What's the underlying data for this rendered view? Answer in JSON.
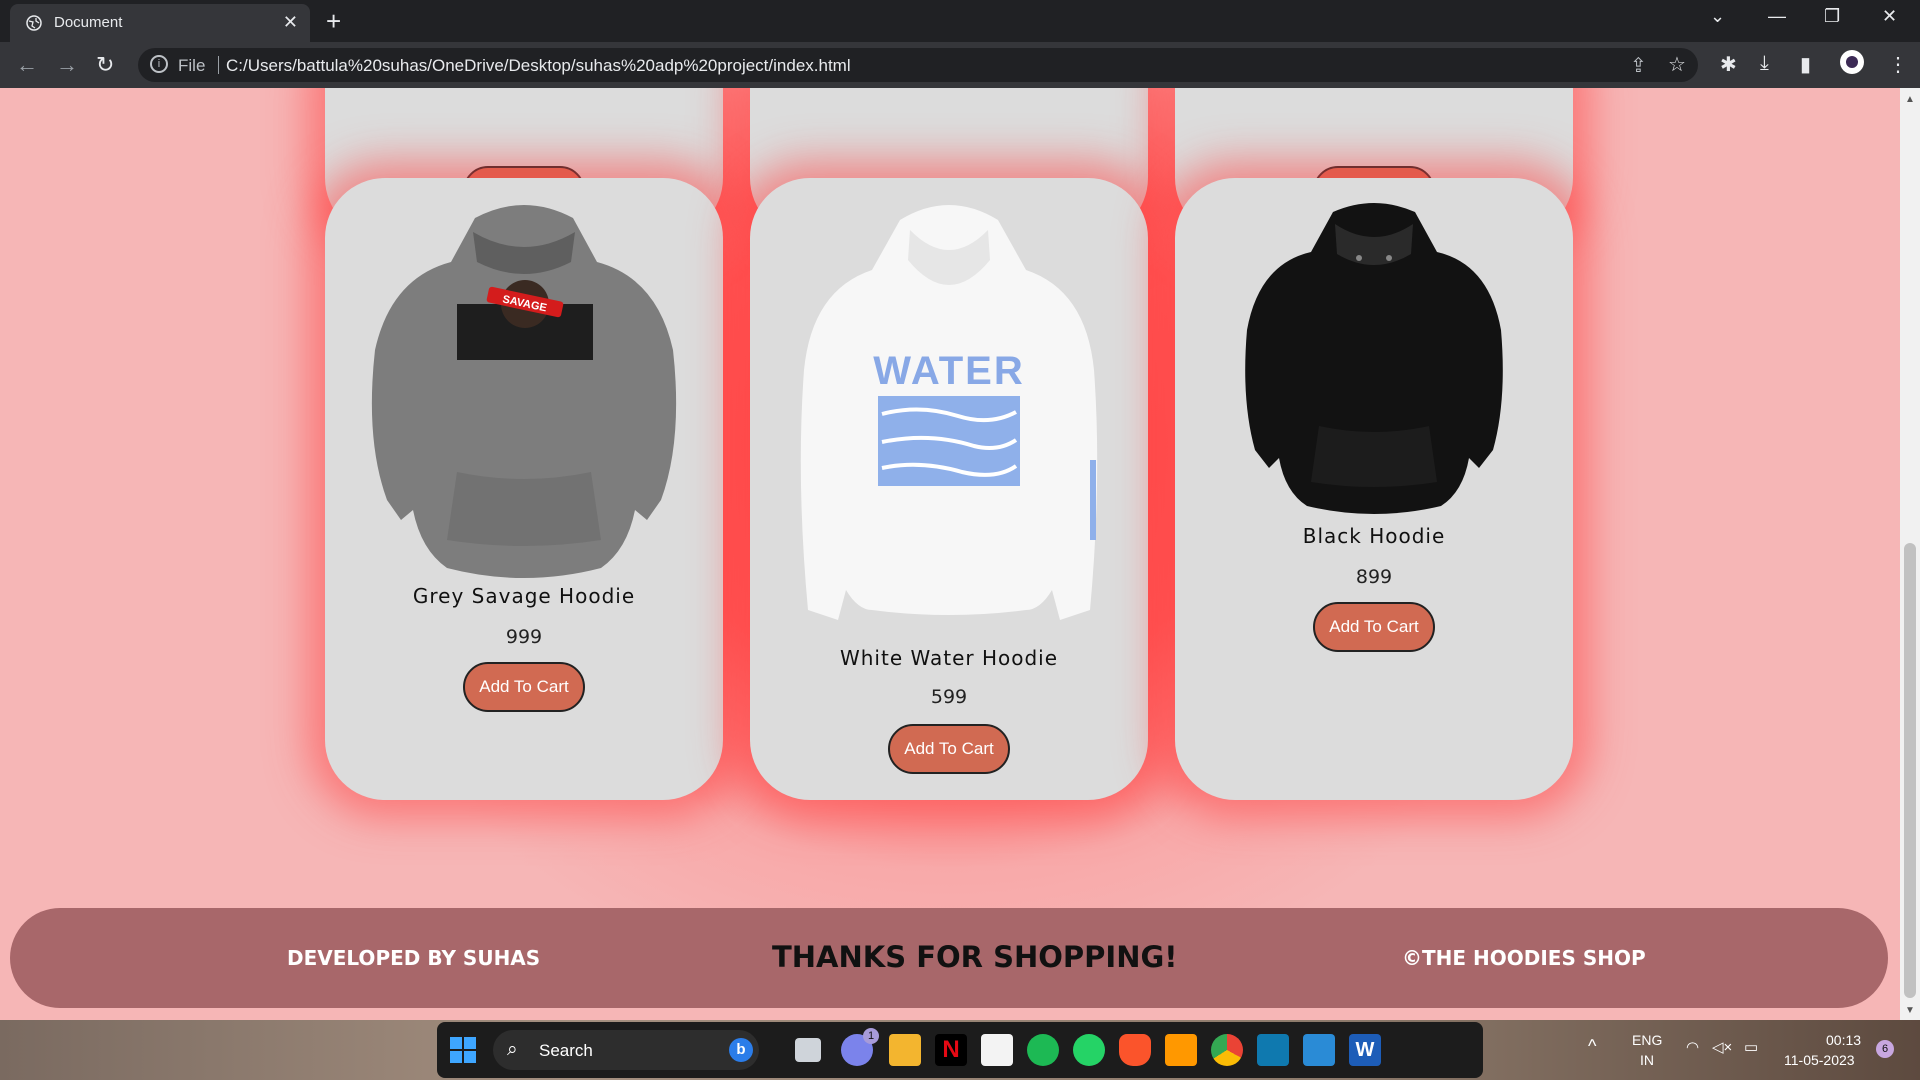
{
  "browser": {
    "tab_title": "Document",
    "address_scheme": "File",
    "address_url": "C:/Users/battula%20suhas/OneDrive/Desktop/suhas%20adp%20project/index.html"
  },
  "top_row": {
    "button_label": "Add To Cart"
  },
  "products": [
    {
      "name": "Grey Savage Hoodie",
      "price": "999",
      "button": "Add To Cart",
      "graphic_text": "SAVAGE"
    },
    {
      "name": "White Water Hoodie",
      "price": "599",
      "button": "Add To Cart",
      "graphic_text": "WATER"
    },
    {
      "name": "Black Hoodie",
      "price": "899",
      "button": "Add To Cart"
    }
  ],
  "footer": {
    "left": "DEVELOPED BY SUHAS",
    "center": "THANKS FOR SHOPPING!",
    "right": "©THE HOODIES SHOP"
  },
  "taskbar": {
    "search_label": "Search",
    "teams_badge": "1",
    "language": "ENG",
    "region": "IN",
    "time": "00:13",
    "date": "11-05-2023",
    "notification_count": "6"
  },
  "colors": {
    "page_accent": "#ff4545",
    "card": "#dcdcdc",
    "button": "#d16a52",
    "footer": "#a8676a"
  }
}
